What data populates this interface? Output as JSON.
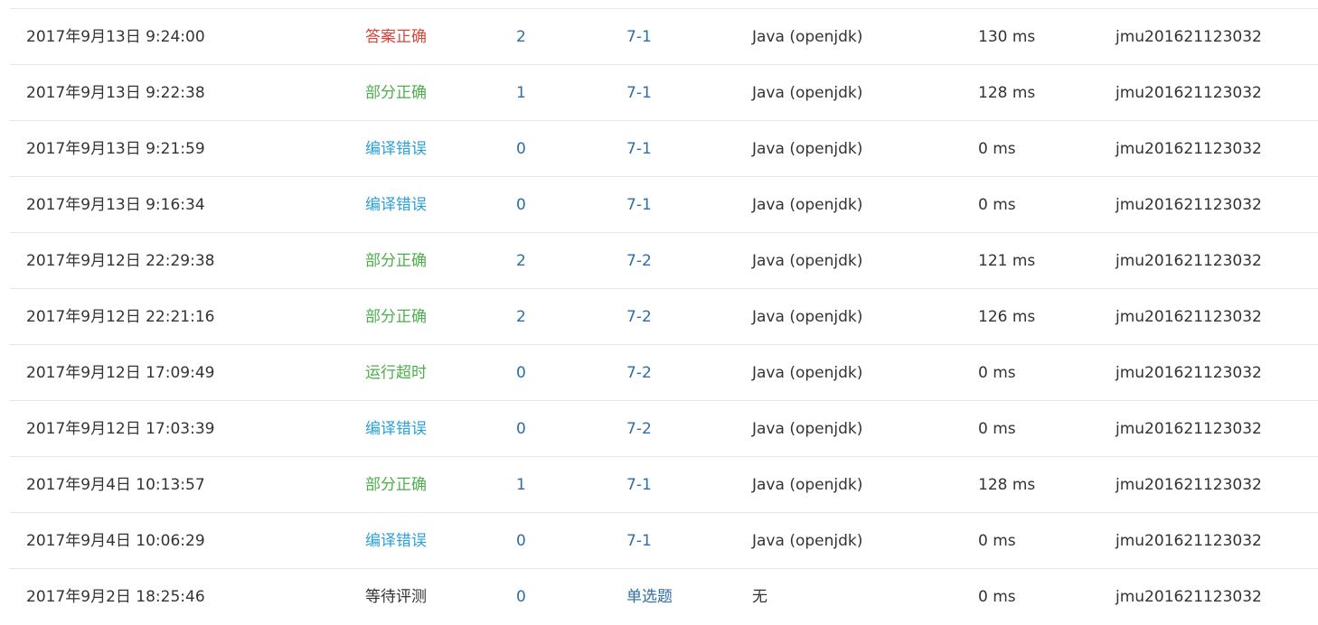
{
  "submissions": [
    {
      "time": "2017年9月13日 9:24:00",
      "status": "答案正确",
      "status_type": "correct",
      "score": "2",
      "problem": "7-1",
      "language": "Java (openjdk)",
      "run_time": "130 ms",
      "user": "jmu201621123032"
    },
    {
      "time": "2017年9月13日 9:22:38",
      "status": "部分正确",
      "status_type": "partial",
      "score": "1",
      "problem": "7-1",
      "language": "Java (openjdk)",
      "run_time": "128 ms",
      "user": "jmu201621123032"
    },
    {
      "time": "2017年9月13日 9:21:59",
      "status": "编译错误",
      "status_type": "compile",
      "score": "0",
      "problem": "7-1",
      "language": "Java (openjdk)",
      "run_time": "0 ms",
      "user": "jmu201621123032"
    },
    {
      "time": "2017年9月13日 9:16:34",
      "status": "编译错误",
      "status_type": "compile",
      "score": "0",
      "problem": "7-1",
      "language": "Java (openjdk)",
      "run_time": "0 ms",
      "user": "jmu201621123032"
    },
    {
      "time": "2017年9月12日 22:29:38",
      "status": "部分正确",
      "status_type": "partial",
      "score": "2",
      "problem": "7-2",
      "language": "Java (openjdk)",
      "run_time": "121 ms",
      "user": "jmu201621123032"
    },
    {
      "time": "2017年9月12日 22:21:16",
      "status": "部分正确",
      "status_type": "partial",
      "score": "2",
      "problem": "7-2",
      "language": "Java (openjdk)",
      "run_time": "126 ms",
      "user": "jmu201621123032"
    },
    {
      "time": "2017年9月12日 17:09:49",
      "status": "运行超时",
      "status_type": "timeout",
      "score": "0",
      "problem": "7-2",
      "language": "Java (openjdk)",
      "run_time": "0 ms",
      "user": "jmu201621123032"
    },
    {
      "time": "2017年9月12日 17:03:39",
      "status": "编译错误",
      "status_type": "compile",
      "score": "0",
      "problem": "7-2",
      "language": "Java (openjdk)",
      "run_time": "0 ms",
      "user": "jmu201621123032"
    },
    {
      "time": "2017年9月4日 10:13:57",
      "status": "部分正确",
      "status_type": "partial",
      "score": "1",
      "problem": "7-1",
      "language": "Java (openjdk)",
      "run_time": "128 ms",
      "user": "jmu201621123032"
    },
    {
      "time": "2017年9月4日 10:06:29",
      "status": "编译错误",
      "status_type": "compile",
      "score": "0",
      "problem": "7-1",
      "language": "Java (openjdk)",
      "run_time": "0 ms",
      "user": "jmu201621123032"
    },
    {
      "time": "2017年9月2日 18:25:46",
      "status": "等待评测",
      "status_type": "pending",
      "score": "0",
      "problem": "单选题",
      "language": "无",
      "run_time": "0 ms",
      "user": "jmu201621123032"
    }
  ],
  "status_colors": {
    "correct": "#d9453b",
    "partial": "#4cae4c",
    "compile": "#2aa0d8",
    "timeout": "#4cae4c",
    "pending": "#333333"
  },
  "link_color": "#2d6ea7"
}
